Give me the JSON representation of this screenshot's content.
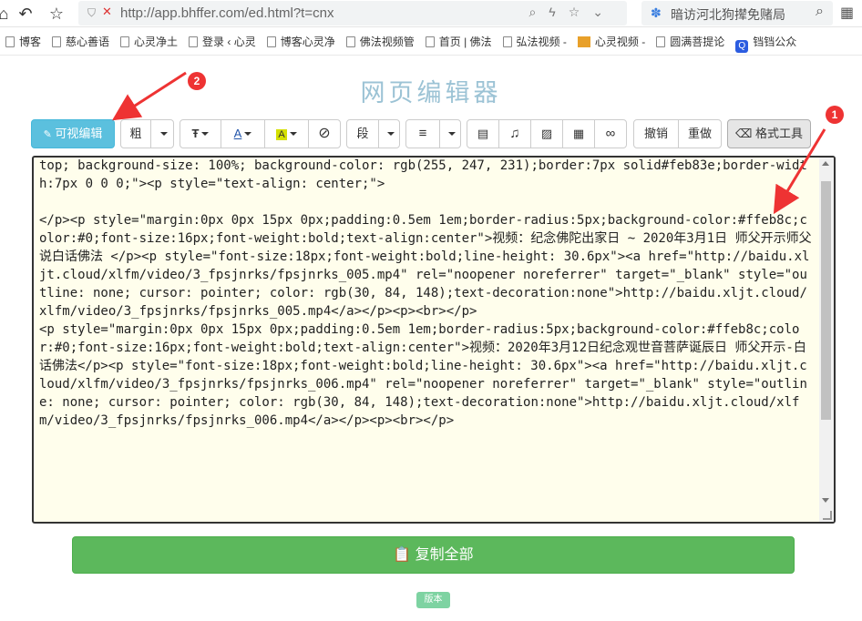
{
  "browser": {
    "url": "http://app.bhffer.com/ed.html?t=cnx",
    "search_text": "暗访河北狗撵免赌局"
  },
  "bookmarks": [
    {
      "label": "博客",
      "icon": "doc"
    },
    {
      "label": "慈心善语",
      "icon": "doc"
    },
    {
      "label": "心灵净土",
      "icon": "doc"
    },
    {
      "label": "登录 ‹ 心灵",
      "icon": "doc"
    },
    {
      "label": "博客心灵净",
      "icon": "doc"
    },
    {
      "label": "佛法视频管",
      "icon": "doc"
    },
    {
      "label": "首页 | 佛法",
      "icon": "doc"
    },
    {
      "label": "弘法视频 -",
      "icon": "doc"
    },
    {
      "label": "心灵视频 -",
      "icon": "image"
    },
    {
      "label": "圆满菩提论",
      "icon": "doc"
    },
    {
      "label": "铛铛公众",
      "icon": "blue"
    }
  ],
  "page": {
    "title": "网页编辑器"
  },
  "toolbar": {
    "visual_edit": "可视编辑",
    "bold": "粗",
    "paragraph": "段",
    "undo": "撤销",
    "redo": "重做",
    "format_tool": "格式工具"
  },
  "editor": {
    "content": "top; background-size: 100%; background-color: rgb(255, 247, 231);border:7px solid#feb83e;border-width:7px 0 0 0;\"><p style=\"text-align: center;\">\n\n</p><p style=\"margin:0px 0px 15px 0px;padding:0.5em 1em;border-radius:5px;background-color:#ffeb8c;color:#0;font-size:16px;font-weight:bold;text-align:center\">视频：纪念佛陀出家日 ~ 2020年3月1日 师父开示师父说白话佛法 </p><p style=\"font-size:18px;font-weight:bold;line-height: 30.6px\"><a href=\"http://baidu.xljt.cloud/xlfm/video/3_fpsjnrks/fpsjnrks_005.mp4\" rel=\"noopener noreferrer\" target=\"_blank\" style=\"outline: none; cursor: pointer; color: rgb(30, 84, 148);text-decoration:none\">http://baidu.xljt.cloud/xlfm/video/3_fpsjnrks/fpsjnrks_005.mp4</a></p><p><br></p>\n<p style=\"margin:0px 0px 15px 0px;padding:0.5em 1em;border-radius:5px;background-color:#ffeb8c;color:#0;font-size:16px;font-weight:bold;text-align:center\">视频：2020年3月12日纪念观世音菩萨诞辰日 师父开示-白话佛法</p><p style=\"font-size:18px;font-weight:bold;line-height: 30.6px\"><a href=\"http://baidu.xljt.cloud/xlfm/video/3_fpsjnrks/fpsjnrks_006.mp4\" rel=\"noopener noreferrer\" target=\"_blank\" style=\"outline: none; cursor: pointer; color: rgb(30, 84, 148);text-decoration:none\">http://baidu.xljt.cloud/xlfm/video/3_fpsjnrks/fpsjnrks_006.mp4</a></p><p><br></p>"
  },
  "copy_all": "复制全部",
  "version_badge": "版本",
  "annotations": {
    "callout_1": "1",
    "callout_2": "2",
    "arrow_color": "#e33333"
  }
}
